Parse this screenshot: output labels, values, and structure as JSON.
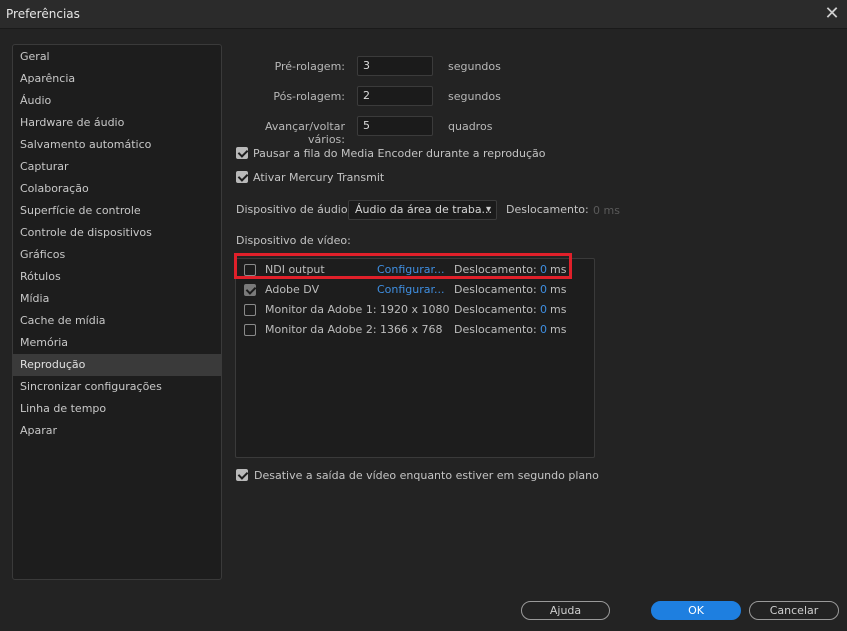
{
  "window": {
    "title": "Preferências",
    "close": "✕"
  },
  "sidebar": {
    "items": [
      "Geral",
      "Aparência",
      "Áudio",
      "Hardware de áudio",
      "Salvamento automático",
      "Capturar",
      "Colaboração",
      "Superfície de controle",
      "Controle de dispositivos",
      "Gráficos",
      "Rótulos",
      "Mídia",
      "Cache de mídia",
      "Memória",
      "Reprodução",
      "Sincronizar configurações",
      "Linha de tempo",
      "Aparar"
    ],
    "active": "Reprodução"
  },
  "playback": {
    "preroll": {
      "label": "Pré-rolagem:",
      "value": "3",
      "unit": "segundos"
    },
    "postroll": {
      "label": "Pós-rolagem:",
      "value": "2",
      "unit": "segundos"
    },
    "step": {
      "label": "Avançar/voltar vários:",
      "value": "5",
      "unit": "quadros"
    },
    "pause_encoder": {
      "label": "Pausar a fila do Media Encoder durante a reprodução",
      "checked": true
    },
    "mercury": {
      "label": "Ativar Mercury Transmit",
      "checked": true
    },
    "audio_device": {
      "label": "Dispositivo de áudio:",
      "selected": "Áudio da área de traba...",
      "offset_label": "Deslocamento:",
      "offset_value": "0 ms"
    },
    "video_device_label": "Dispositivo de vídeo:",
    "video_devices": [
      {
        "name": "NDI output",
        "configure": "Configurar...",
        "offset_label": "Deslocamento:",
        "offset": "0",
        "unit": "ms",
        "checked": false
      },
      {
        "name": "Adobe DV",
        "configure": "Configurar...",
        "offset_label": "Deslocamento:",
        "offset": "0",
        "unit": "ms",
        "checked": true
      },
      {
        "name": "Monitor da Adobe 1: 1920 x 1080",
        "configure": "",
        "offset_label": "Deslocamento:",
        "offset": "0",
        "unit": "ms",
        "checked": false
      },
      {
        "name": "Monitor da Adobe 2: 1366 x 768",
        "configure": "",
        "offset_label": "Deslocamento:",
        "offset": "0",
        "unit": "ms",
        "checked": false
      }
    ],
    "disable_bg": {
      "label": "Desative a saída de vídeo enquanto estiver em segundo plano",
      "checked": true
    }
  },
  "buttons": {
    "help": "Ajuda",
    "ok": "OK",
    "cancel": "Cancelar"
  },
  "colors": {
    "accent": "#1e7fe0",
    "link": "#3f8ee0",
    "highlight": "#e0202a"
  }
}
